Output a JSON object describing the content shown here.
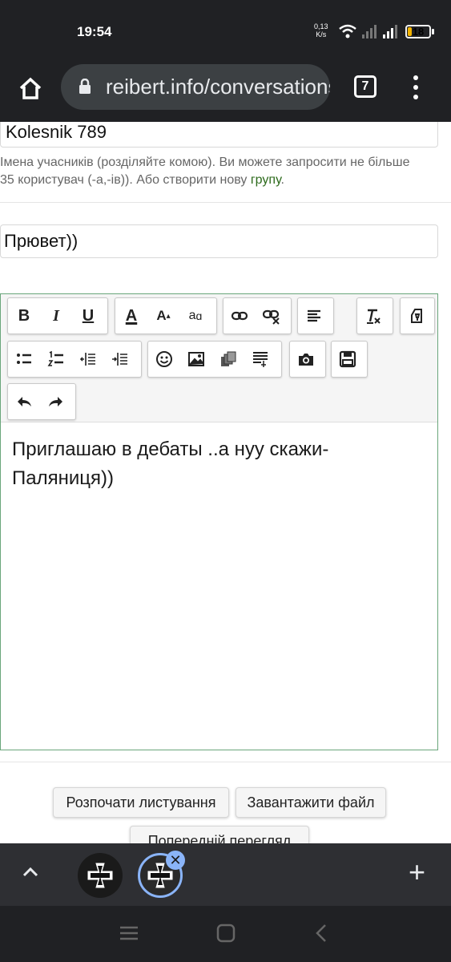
{
  "status": {
    "time": "19:54",
    "net_speed_value": "0,13",
    "net_speed_unit": "K/s",
    "battery": "18",
    "battery_level": 0.18
  },
  "browser": {
    "url": "reibert.info/conversations",
    "tab_count": "7"
  },
  "form": {
    "recipient_value": "Kolesnik 789",
    "hint_text": "Імена учасників (розділяйте комою). Ви можете запросити не більше 35 користувач (-а,-ів)). Або створити нову ",
    "hint_link": "групу",
    "hint_end": ".",
    "title_value": "Прювет))",
    "message_text": "Приглашаю в дебаты ..а нуу скажи-Паляниця))"
  },
  "toolbar": {
    "bold": "B",
    "italic": "I",
    "underline": "U",
    "font_color": "A",
    "font_size": "A",
    "font_family": "a"
  },
  "actions": {
    "start_conversation": "Розпочати листування",
    "upload_file": "Завантажити файл",
    "preview": "Попередній перегляд"
  },
  "colors": {
    "accent_link": "#2c6a1b",
    "editor_border": "#6aa67b",
    "tab_highlight": "#8ab4f8"
  }
}
